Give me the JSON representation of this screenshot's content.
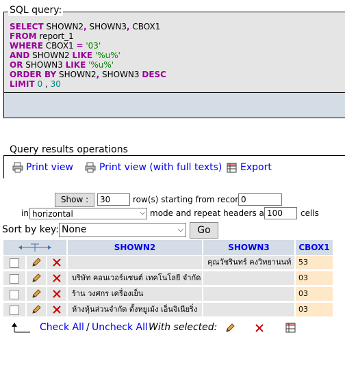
{
  "sql_query": {
    "legend": "SQL query:",
    "lines": [
      [
        {
          "t": "SELECT",
          "c": "kw"
        },
        {
          "t": " SHOWN2",
          "c": ""
        },
        {
          "t": ",",
          "c": "kw"
        },
        {
          "t": " SHOWN3",
          "c": ""
        },
        {
          "t": ",",
          "c": "kw"
        },
        {
          "t": " CBOX1",
          "c": ""
        }
      ],
      [
        {
          "t": "FROM",
          "c": "kw"
        },
        {
          "t": " report_1",
          "c": ""
        }
      ],
      [
        {
          "t": "WHERE",
          "c": "kw"
        },
        {
          "t": " CBOX1 ",
          "c": ""
        },
        {
          "t": "=",
          "c": "kw"
        },
        {
          "t": " ",
          "c": ""
        },
        {
          "t": "'03'",
          "c": "str"
        }
      ],
      [
        {
          "t": "AND",
          "c": "kw"
        },
        {
          "t": " SHOWN2 ",
          "c": ""
        },
        {
          "t": "LIKE",
          "c": "kw"
        },
        {
          "t": " ",
          "c": ""
        },
        {
          "t": "'%u%'",
          "c": "str"
        }
      ],
      [
        {
          "t": "OR",
          "c": "kw"
        },
        {
          "t": " SHOWN3 ",
          "c": ""
        },
        {
          "t": "LIKE",
          "c": "kw"
        },
        {
          "t": " ",
          "c": ""
        },
        {
          "t": "'%u%'",
          "c": "str"
        }
      ],
      [
        {
          "t": "ORDER BY",
          "c": "kw"
        },
        {
          "t": " SHOWN2",
          "c": ""
        },
        {
          "t": ",",
          "c": "kw"
        },
        {
          "t": " SHOWN3 ",
          "c": ""
        },
        {
          "t": "DESC",
          "c": "kw"
        }
      ],
      [
        {
          "t": "LIMIT",
          "c": "kw"
        },
        {
          "t": " ",
          "c": ""
        },
        {
          "t": "0",
          "c": "num"
        },
        {
          "t": " , ",
          "c": ""
        },
        {
          "t": "30",
          "c": "num"
        }
      ]
    ]
  },
  "operations": {
    "legend": "Query results operations",
    "print_view": "Print view",
    "print_view_full": "Print view (with full texts)",
    "export": "Export"
  },
  "nav": {
    "show_button": "Show :",
    "rows_value": "30",
    "rows_label": "row(s) starting from record #",
    "start_value": "0",
    "in_label": "in",
    "mode_selected": "horizontal",
    "mode_label": "mode and repeat headers after",
    "repeat_value": "100",
    "cells_label": "cells",
    "sort_label": "Sort by key:",
    "sort_selected": "None",
    "go_button": "Go"
  },
  "table": {
    "columns": [
      "SHOWN2",
      "SHOWN3",
      "CBOX1"
    ],
    "rows": [
      {
        "shown2": "",
        "shown3": "คุณวัชรินทร์ คงวิทยานนท์",
        "cbox1": "53"
      },
      {
        "shown2": "บริษัท คอนเวอร์แซนต์ เทคโนโลยี จำกัด",
        "shown3": "",
        "cbox1": "03"
      },
      {
        "shown2": "ร้าน วงศกร เครื่องเย็น",
        "shown3": "",
        "cbox1": "03"
      },
      {
        "shown2": "ห้างหุ้นส่วนจำกัด ตั้งหยูเม้ง เอ็นจิเนียริ่ง",
        "shown3": "",
        "cbox1": "03"
      }
    ]
  },
  "footer": {
    "check_all": "Check All",
    "separator": "/",
    "uncheck_all": "Uncheck All",
    "with_selected": "With selected:"
  },
  "colors": {
    "keyword": "#990099",
    "string": "#008000",
    "number": "#008080",
    "link": "#0000ee",
    "header_bg": "#d4dce6",
    "row_bg": "#e5e5e5",
    "num_bg": "#ffe8c8"
  }
}
